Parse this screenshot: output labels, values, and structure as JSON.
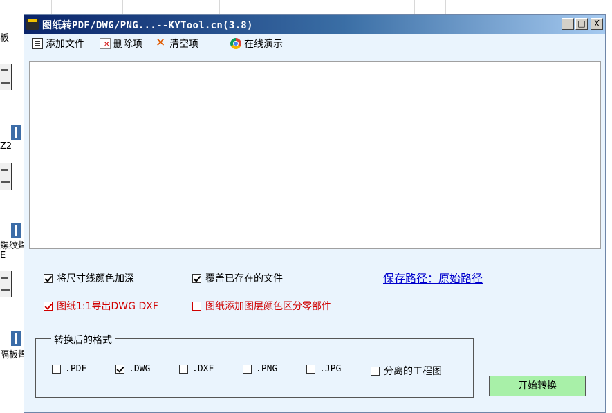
{
  "background": {
    "left_labels": [
      "板",
      "Z2",
      "螺纹焊",
      "E",
      "隔板焊"
    ]
  },
  "window": {
    "title": "图纸转PDF/DWG/PNG...--KYTool.cn(3.8)",
    "controls": {
      "minimize": "_",
      "maximize": "□",
      "close": "X"
    }
  },
  "toolbar": {
    "add_file": "添加文件",
    "delete_item": "删除项",
    "clear_items": "清空项",
    "online_demo": "在线演示"
  },
  "options": {
    "deepen_dimension_color": {
      "label": "将尺寸线颜色加深",
      "checked": true
    },
    "overwrite_existing": {
      "label": "覆盖已存在的文件",
      "checked": true
    },
    "save_path_link": "保存路径：原始路径",
    "export_1to1": {
      "label": "图纸1:1导出DWG DXF",
      "checked": true,
      "color": "#d00000"
    },
    "layer_color_parts": {
      "label": "图纸添加图层颜色区分零部件",
      "checked": false,
      "color": "#d00000"
    }
  },
  "format_group": {
    "title": "转换后的格式",
    "formats": [
      {
        "label": ".PDF",
        "checked": false
      },
      {
        "label": ".DWG",
        "checked": true
      },
      {
        "label": ".DXF",
        "checked": false
      },
      {
        "label": ".PNG",
        "checked": false
      },
      {
        "label": ".JPG",
        "checked": false
      },
      {
        "label": "分离的工程图",
        "checked": false
      }
    ]
  },
  "start_button": {
    "label": "开始转换",
    "color": "#a8f0a8"
  }
}
